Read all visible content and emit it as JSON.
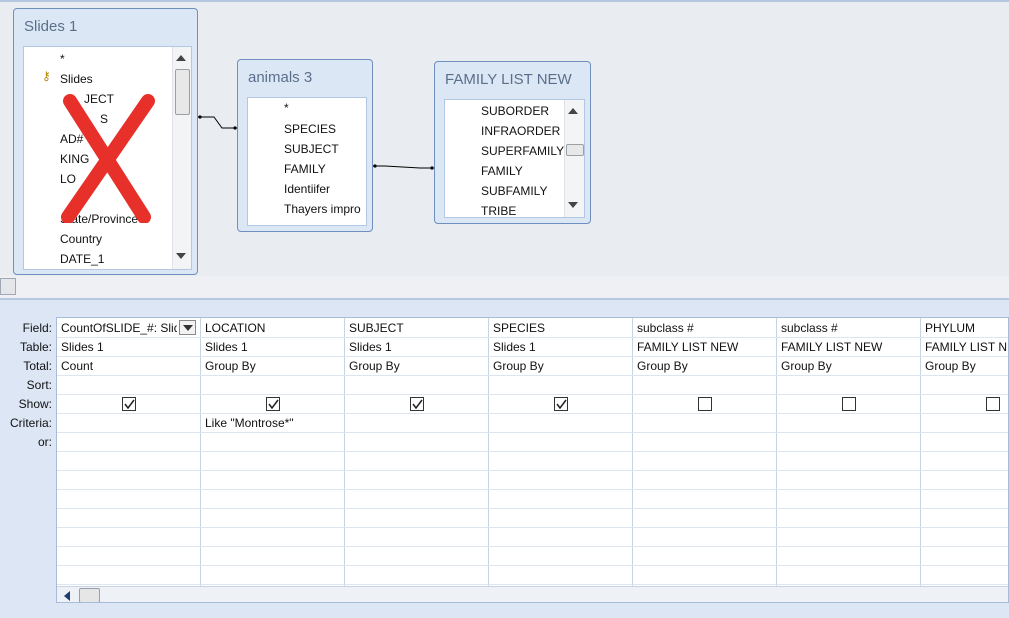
{
  "tables": [
    {
      "title": "Slides 1",
      "fields": [
        "*",
        "Slides",
        "SUBJECT",
        "SPECIES",
        "AD#",
        "KINGDOM",
        "LOCATION",
        "",
        "State/Province",
        "Country",
        "DATE_1"
      ],
      "fields_visible": [
        "*",
        "Slides",
        "JECT",
        "S",
        "AD#",
        "KING",
        "LO",
        "",
        "State/Province",
        "Country",
        "DATE_1"
      ],
      "key_icon": "key-icon"
    },
    {
      "title": "animals 3",
      "fields": [
        "*",
        "SPECIES",
        "SUBJECT",
        "FAMILY",
        "Identiifer",
        "Thayers impro"
      ]
    },
    {
      "title": "FAMILY LIST NEW",
      "fields": [
        "SUBORDER",
        "INFRAORDER",
        "SUPERFAMILY",
        "FAMILY",
        "SUBFAMILY",
        "TRIBE"
      ]
    }
  ],
  "delete_mark": {
    "icon": "red-x-icon",
    "color": "#e8302a"
  },
  "row_labels": [
    "Field:",
    "Table:",
    "Total:",
    "Sort:",
    "Show:",
    "Criteria:",
    "or:"
  ],
  "columns": [
    {
      "field": "CountOfSLIDE_#: Slid",
      "table": "Slides 1",
      "total": "Count",
      "sort": "",
      "show": true,
      "criteria": ""
    },
    {
      "field": "LOCATION",
      "table": "Slides 1",
      "total": "Group By",
      "sort": "",
      "show": true,
      "criteria": "Like \"Montrose*\""
    },
    {
      "field": "SUBJECT",
      "table": "Slides 1",
      "total": "Group By",
      "sort": "",
      "show": true,
      "criteria": ""
    },
    {
      "field": "SPECIES",
      "table": "Slides 1",
      "total": "Group By",
      "sort": "",
      "show": true,
      "criteria": ""
    },
    {
      "field": "subclass #",
      "table": "FAMILY LIST NEW",
      "total": "Group By",
      "sort": "",
      "show": false,
      "criteria": ""
    },
    {
      "field": "subclass #",
      "table": "FAMILY LIST NEW",
      "total": "Group By",
      "sort": "",
      "show": false,
      "criteria": ""
    },
    {
      "field": "PHYLUM",
      "table": "FAMILY LIST NE",
      "total": "Group By",
      "sort": "",
      "show": false,
      "criteria": ""
    }
  ],
  "colors": {
    "pane_bg": "#e9ecf0",
    "grid_bg": "#dce6f4",
    "table_border": "#6f8fbf"
  }
}
